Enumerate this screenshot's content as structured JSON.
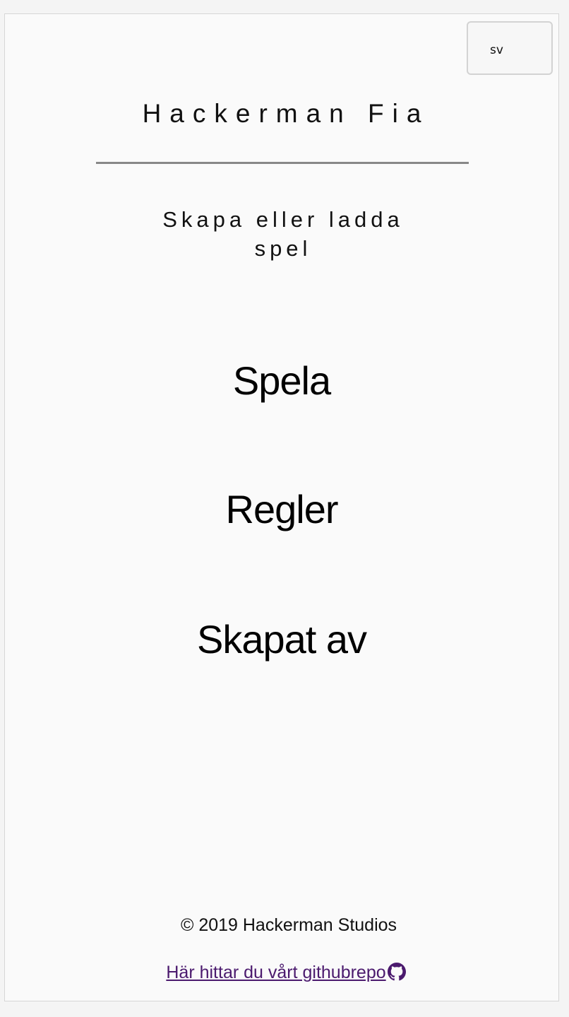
{
  "language_select": {
    "value": "sv"
  },
  "header": {
    "title": "Hackerman Fia",
    "subtitle": "Skapa eller ladda spel"
  },
  "menu": {
    "play": "Spela",
    "rules": "Regler",
    "credits": "Skapat av"
  },
  "footer": {
    "copyright": "© 2019 Hackerman Studios",
    "github_link_text": "Här hittar du vårt githubrepo",
    "github_icon": "github-icon",
    "link_color": "#4b1a6e"
  }
}
